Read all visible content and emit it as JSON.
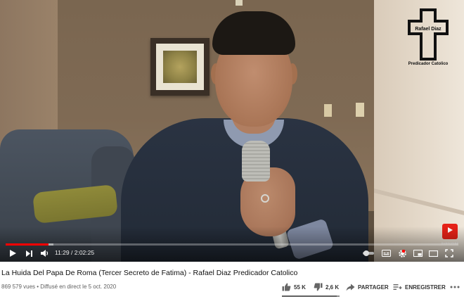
{
  "logo": {
    "name": "Rafael Diaz",
    "subtitle": "Predicador Catolico"
  },
  "player": {
    "current_time": "11:29",
    "duration": "2:02:25",
    "time_display": "11:29 / 2:02:25",
    "progress_fraction": 0.094,
    "buffer_fraction": 0.105,
    "subscribe_badge": "SUBSCRIBE"
  },
  "video": {
    "title": "La Huida Del Papa De Roma (Tercer Secreto de Fatima) - Rafael Diaz Predicador Catolico",
    "meta": "869 579 vues • Diffusé en direct le 5 oct. 2020"
  },
  "actions": {
    "likes": "55 K",
    "dislikes": "2,6 K",
    "share": "PARTAGER",
    "save": "ENREGISTRER",
    "like_fraction": 0.955
  },
  "colors": {
    "progress": "#ff0000",
    "badge": "#e62117"
  },
  "icons": [
    "play-icon",
    "next-icon",
    "volume-icon",
    "autoplay-toggle-icon",
    "subtitles-icon",
    "settings-icon",
    "miniplayer-icon",
    "theater-icon",
    "fullscreen-icon",
    "thumbs-up-icon",
    "thumbs-down-icon",
    "share-icon",
    "save-icon",
    "more-icon"
  ]
}
